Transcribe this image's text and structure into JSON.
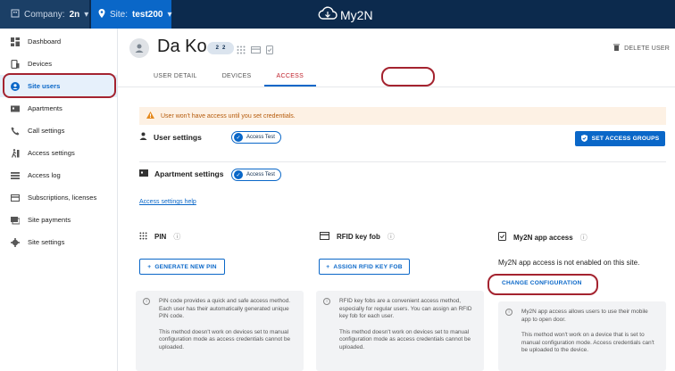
{
  "topbar": {
    "company_label": "Company:",
    "company_value": "2n",
    "site_label": "Site:",
    "site_value": "test200",
    "logo_text": "My2N"
  },
  "sidebar": {
    "items": [
      {
        "label": "Dashboard",
        "icon": "dashboard-icon"
      },
      {
        "label": "Devices",
        "icon": "devices-icon"
      },
      {
        "label": "Site users",
        "icon": "users-icon"
      },
      {
        "label": "Apartments",
        "icon": "apartment-icon"
      },
      {
        "label": "Call settings",
        "icon": "phone-icon"
      },
      {
        "label": "Access settings",
        "icon": "access-icon"
      },
      {
        "label": "Access log",
        "icon": "list-icon"
      },
      {
        "label": "Subscriptions, licenses",
        "icon": "card-icon"
      },
      {
        "label": "Site payments",
        "icon": "payment-icon"
      },
      {
        "label": "Site settings",
        "icon": "gear-icon"
      }
    ],
    "active_index": 2
  },
  "user": {
    "name": "Da Ko",
    "badge_left": "2",
    "badge_right": "2"
  },
  "header": {
    "delete_label": "DELETE USER",
    "tabs": [
      "USER DETAIL",
      "DEVICES",
      "ACCESS"
    ],
    "active_tab": 2
  },
  "alert": {
    "text": "User won't have access until you set credentials."
  },
  "user_settings": {
    "title": "User settings",
    "chip": "Access Test",
    "button": "SET ACCESS GROUPS"
  },
  "apartment_settings": {
    "title": "Apartment settings",
    "chip": "Access Test"
  },
  "help_link": "Access settings help",
  "pin": {
    "title": "PIN",
    "button": "GENERATE NEW PIN",
    "info_p1": "PIN code provides a quick and safe access method. Each user has their automatically generated unique PIN code.",
    "info_p2": "This method doesn't work on devices set to manual configuration mode as access credentials cannot be uploaded."
  },
  "rfid": {
    "title": "RFID key fob",
    "button": "ASSIGN RFID KEY FOB",
    "info_p1": "RFID key fobs are a convenient access method, especially for regular users. You can assign an RFID key fob for each user.",
    "info_p2": "This method doesn't work on devices set to manual configuration mode as access credentials cannot be uploaded."
  },
  "my2n": {
    "title": "My2N app access",
    "message": "My2N app access is not enabled on this site.",
    "button": "CHANGE CONFIGURATION",
    "info_p1": "My2N app access allows users to use their mobile app to open door.",
    "info_p2": "This method won't work on a device that is set to manual configuration mode. Access credentials can't be uploaded to the device."
  },
  "colors": {
    "primary": "#0a67c8",
    "topbar": "#0c2a4d",
    "highlight": "#a4232f",
    "alert_bg": "#fdf1e4",
    "alert_text": "#b55a0a"
  }
}
